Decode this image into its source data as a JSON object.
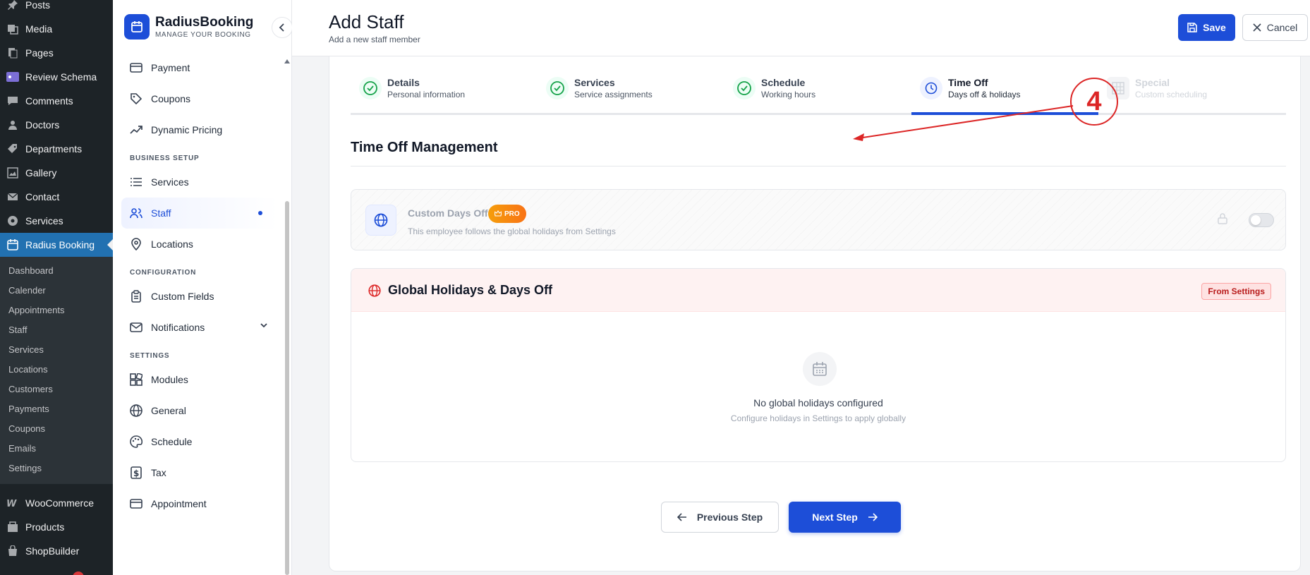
{
  "wp_menu": {
    "items_top": [
      {
        "label": "Posts",
        "icon": "pin-icon"
      },
      {
        "label": "Media",
        "icon": "media-icon"
      },
      {
        "label": "Pages",
        "icon": "pages-icon"
      },
      {
        "label": "Review Schema",
        "icon": "review-schema-icon"
      },
      {
        "label": "Comments",
        "icon": "comments-icon"
      },
      {
        "label": "Doctors",
        "icon": "user-icon"
      },
      {
        "label": "Departments",
        "icon": "tag-icon"
      },
      {
        "label": "Gallery",
        "icon": "gallery-icon"
      },
      {
        "label": "Contact",
        "icon": "mail-icon"
      },
      {
        "label": "Services",
        "icon": "services-icon"
      }
    ],
    "active": {
      "label": "Radius Booking",
      "icon": "calendar-icon"
    },
    "submenu": [
      "Dashboard",
      "Calender",
      "Appointments",
      "Staff",
      "Services",
      "Locations",
      "Customers",
      "Payments",
      "Coupons",
      "Emails",
      "Settings"
    ],
    "items_bottom": [
      {
        "label": "WooCommerce",
        "icon": "woo-icon"
      },
      {
        "label": "Products",
        "icon": "products-icon"
      },
      {
        "label": "ShopBuilder",
        "icon": "bag-icon"
      }
    ]
  },
  "plugin": {
    "brand_name": "RadiusBooking",
    "brand_tagline": "MANAGE YOUR BOOKING",
    "nav": {
      "payment": "Payment",
      "coupons": "Coupons",
      "dynamic_pricing": "Dynamic Pricing",
      "business_setup_heading": "BUSINESS SETUP",
      "services": "Services",
      "staff": "Staff",
      "locations": "Locations",
      "configuration_heading": "CONFIGURATION",
      "custom_fields": "Custom Fields",
      "notifications": "Notifications",
      "settings_heading": "SETTINGS",
      "modules": "Modules",
      "general": "General",
      "schedule": "Schedule",
      "tax": "Tax",
      "appointment": "Appointment"
    }
  },
  "header": {
    "title": "Add Staff",
    "subtitle": "Add a new staff member",
    "save_label": "Save",
    "cancel_label": "Cancel"
  },
  "steps": [
    {
      "title": "Details",
      "subtitle": "Personal information",
      "state": "done"
    },
    {
      "title": "Services",
      "subtitle": "Service assignments",
      "state": "done"
    },
    {
      "title": "Schedule",
      "subtitle": "Working hours",
      "state": "done"
    },
    {
      "title": "Time Off",
      "subtitle": "Days off & holidays",
      "state": "current"
    },
    {
      "title": "Special",
      "subtitle": "Custom scheduling",
      "state": "future"
    }
  ],
  "annotation": {
    "number": "4",
    "color": "#dc2626"
  },
  "time_off": {
    "section_title": "Time Off Management",
    "custom_days_off": {
      "title": "Custom Days Off",
      "badge": "PRO",
      "description": "This employee follows the global holidays from Settings"
    },
    "global_holidays": {
      "title": "Global Holidays & Days Off",
      "badge": "From Settings",
      "empty_title": "No global holidays configured",
      "empty_description": "Configure holidays in Settings to apply globally"
    }
  },
  "footer": {
    "previous_label": "Previous Step",
    "next_label": "Next Step"
  },
  "colors": {
    "primary": "#1d4ed8",
    "wp_sidebar": "#1d2327",
    "wp_active": "#2271b1",
    "success": "#16a34a",
    "danger": "#dc2626",
    "pro": "#f59e0b"
  }
}
